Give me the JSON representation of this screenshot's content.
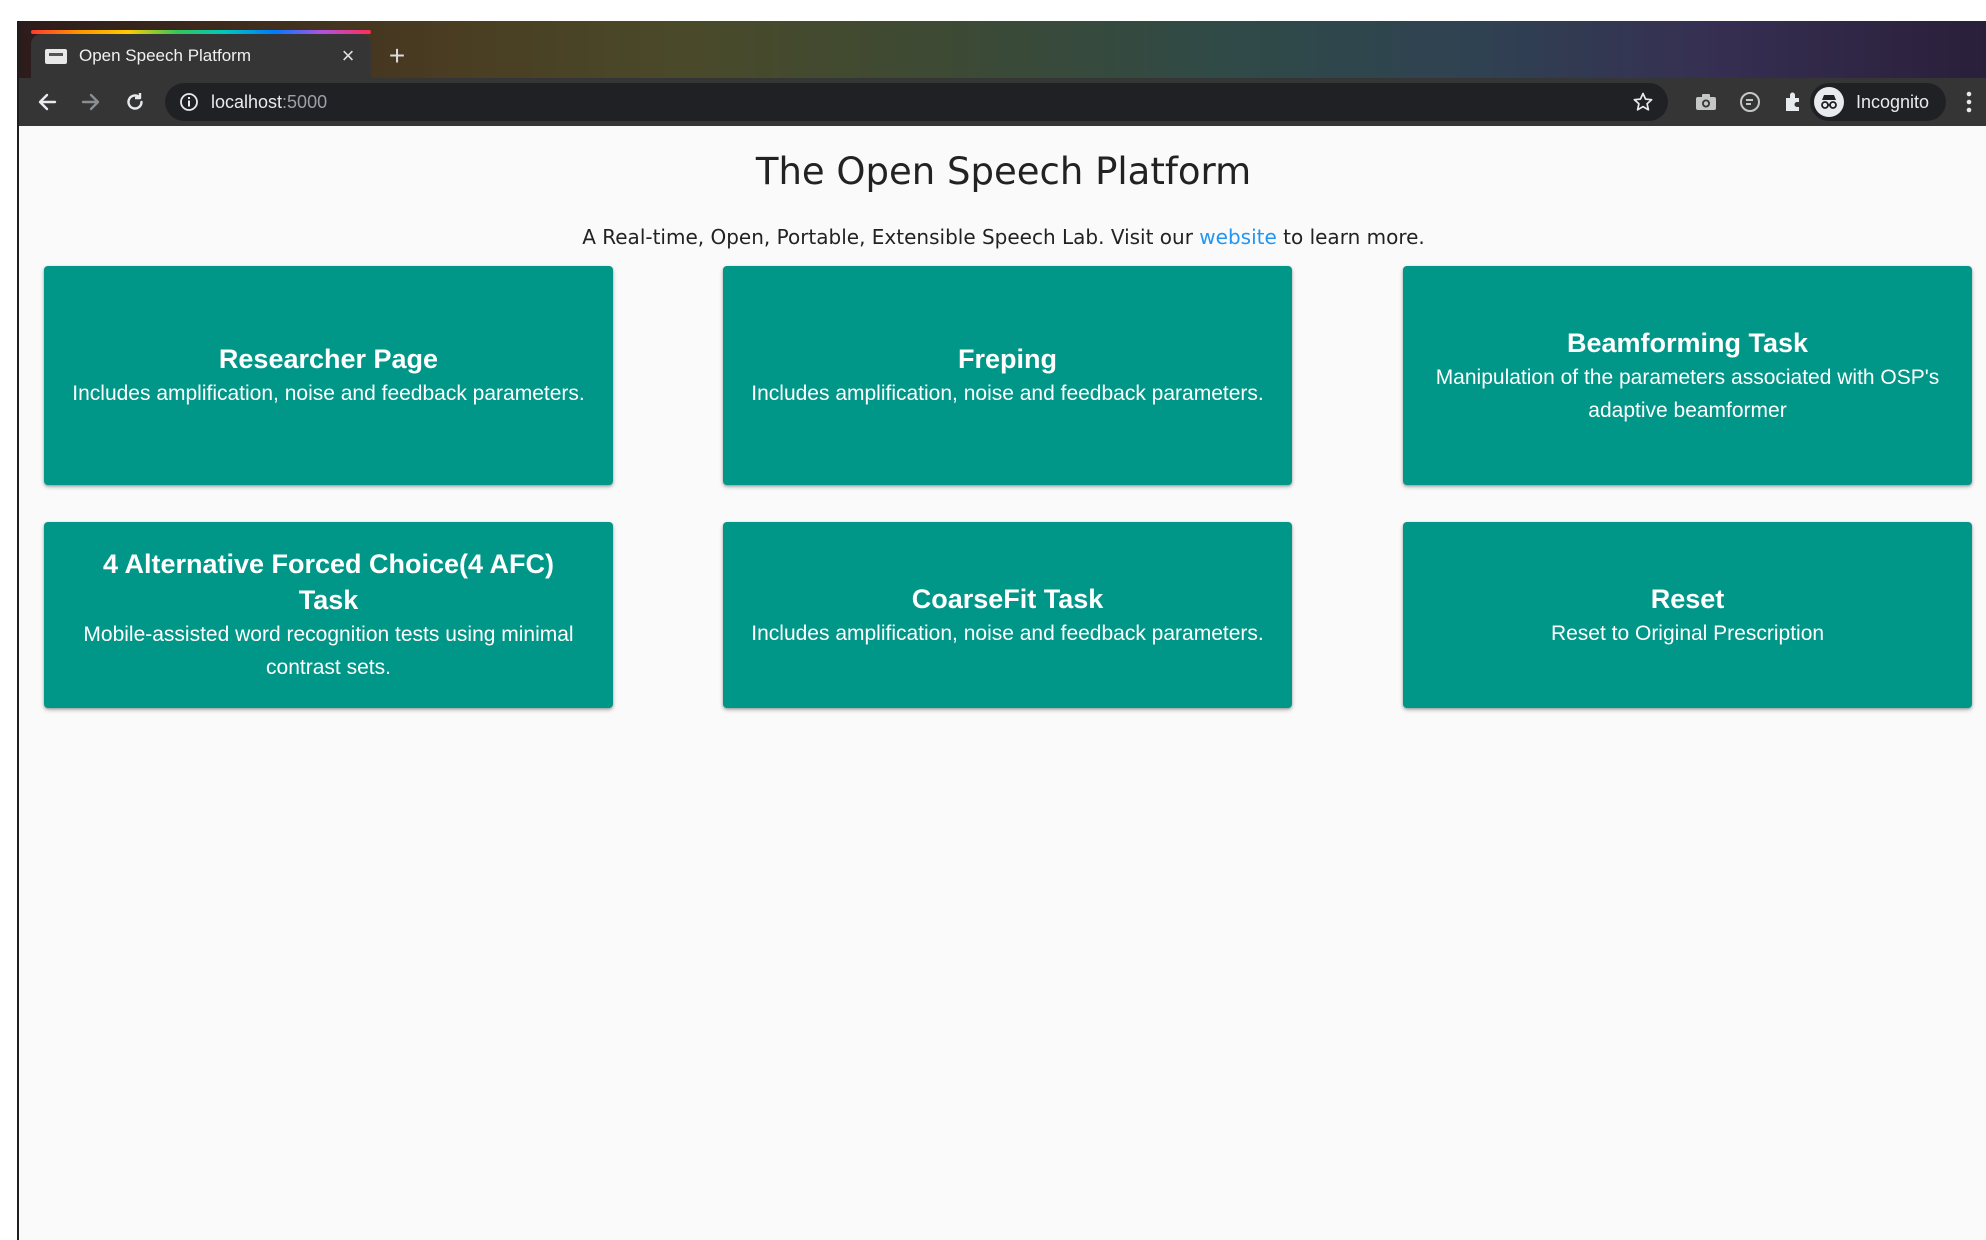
{
  "browser": {
    "tab_title": "Open Speech Platform",
    "url_host": "localhost",
    "url_port": ":5000",
    "profile_label": "Incognito"
  },
  "page": {
    "title": "The Open Speech Platform",
    "subtitle_before": "A Real-time, Open, Portable, Extensible Speech Lab. Visit our ",
    "subtitle_link": "website",
    "subtitle_after": " to learn more."
  },
  "cards": [
    {
      "title": "Researcher Page",
      "description": "Includes amplification, noise and feedback parameters."
    },
    {
      "title": "Freping",
      "description": "Includes amplification, noise and feedback parameters."
    },
    {
      "title": "Beamforming Task",
      "description": "Manipulation of the parameters associated with OSP's adaptive beamformer"
    },
    {
      "title": "4 Alternative Forced Choice(4 AFC) Task",
      "description": "Mobile-assisted word recognition tests using minimal contrast sets."
    },
    {
      "title": "CoarseFit Task",
      "description": "Includes amplification, noise and feedback parameters."
    },
    {
      "title": "Reset",
      "description": "Reset to Original Prescription"
    }
  ],
  "colors": {
    "card": "#009688",
    "link": "#2196f3",
    "page_bg": "#fafafa"
  }
}
